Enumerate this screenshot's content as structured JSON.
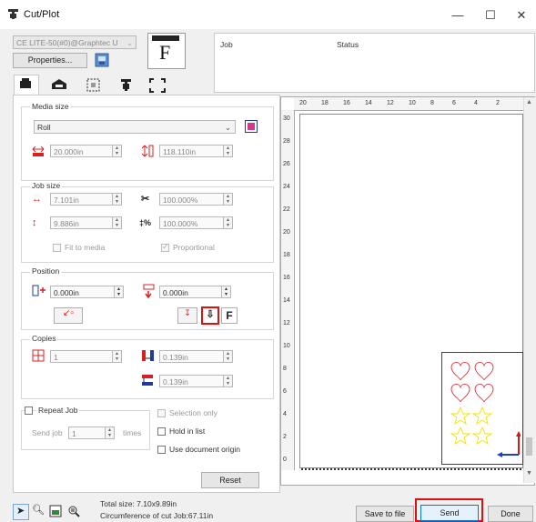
{
  "window": {
    "title": "Cut/Plot",
    "minimize": "—",
    "maximize": "☐",
    "close": "✕"
  },
  "device": {
    "name": "CE LITE-50(#0)@Graphtec U",
    "properties_label": "Properties..."
  },
  "job_table": {
    "col_job": "Job",
    "col_status": "Status"
  },
  "media_size": {
    "title": "Media size",
    "selected": "Roll",
    "width": "20.000in",
    "height": "118.110in"
  },
  "job_size": {
    "title": "Job size",
    "width": "7.101in",
    "height": "9.886in",
    "scale_x": "100.000%",
    "scale_y": "100.000%",
    "fit_to_media": "Fit to media",
    "proportional": "Proportional"
  },
  "position": {
    "title": "Position",
    "x": "0.000in",
    "y": "0.000in"
  },
  "copies": {
    "title": "Copies",
    "count": "1",
    "gap_x": "0.139in",
    "gap_y": "0.139in"
  },
  "repeat": {
    "repeat_job": "Repeat Job",
    "send_job": "Send job",
    "send_count": "1",
    "times": "times",
    "selection_only": "Selection only",
    "hold_in_list": "Hold in list",
    "use_origin": "Use document origin",
    "reset": "Reset"
  },
  "ruler": {
    "top_ticks": [
      "20",
      "18",
      "16",
      "14",
      "12",
      "10",
      "8",
      "6",
      "4",
      "2"
    ],
    "left_ticks": [
      "30",
      "28",
      "26",
      "24",
      "22",
      "20",
      "18",
      "16",
      "14",
      "12",
      "10",
      "8",
      "6",
      "4",
      "2",
      "0"
    ]
  },
  "status": {
    "total_size": "Total size: 7.10x9.89in",
    "circumference": "Circumference of cut Job:67.11in"
  },
  "footer": {
    "save_to_file": "Save to file",
    "send": "Send",
    "done": "Done"
  },
  "colors": {
    "hearts": "#e0202a",
    "stars": "#f2e300",
    "highlight": "#e01010",
    "origin_x": "#1a3fd6",
    "origin_y": "#d81818"
  }
}
